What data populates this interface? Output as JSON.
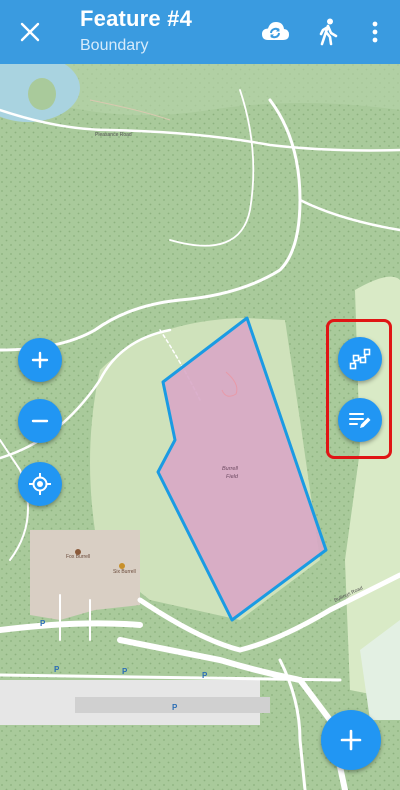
{
  "header": {
    "title": "Feature #4",
    "subtitle": "Boundary",
    "close_icon": "close-icon",
    "sync_icon": "cloud-sync-icon",
    "track_icon": "walking-person-icon",
    "menu_icon": "more-vert-icon"
  },
  "map": {
    "field_label_1": "Burrell",
    "field_label_2": "Field",
    "poi_label_1": "Fox Burrell",
    "poi_label_2": "Six Burrell",
    "street_1": "Pleasance Road",
    "street_2": "Bullings Road",
    "colors": {
      "forest": "#a8c99a",
      "meadow": "#d5e8c0",
      "feature_fill": "#d8a7c7",
      "feature_stroke": "#1a9be3",
      "road": "#ffffff",
      "water": "#a9d3e0"
    }
  },
  "controls": {
    "zoom_in_icon": "plus-icon",
    "zoom_out_icon": "minus-icon",
    "locate_icon": "gps-locate-icon",
    "edit_geometry_icon": "edit-geometry-icon",
    "edit_attributes_icon": "edit-attributes-icon",
    "add_icon": "plus-icon"
  }
}
